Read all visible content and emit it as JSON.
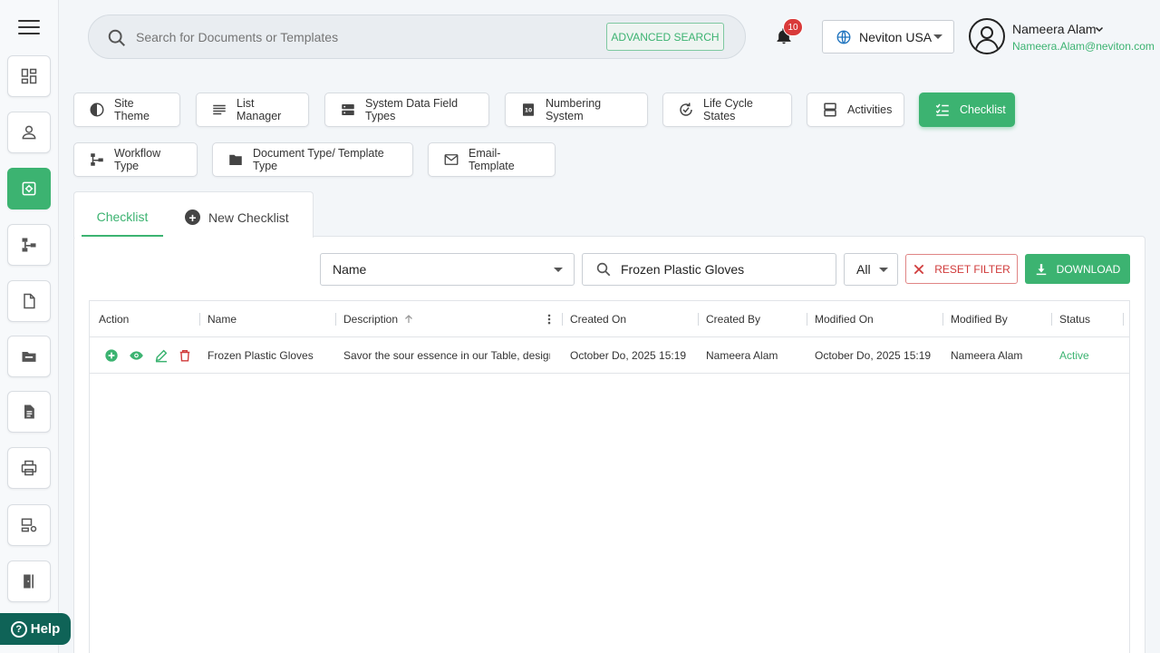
{
  "header": {
    "search_placeholder": "Search for Documents or Templates",
    "advanced_search_label": "ADVANCED SEARCH",
    "notification_count": "10",
    "org_name": "Neviton USA",
    "user_name": "Nameera Alam",
    "user_email": "Nameera.Alam@neviton.com"
  },
  "sidebar": {
    "items": [
      {
        "icon": "dashboard-icon"
      },
      {
        "icon": "user-icon"
      },
      {
        "icon": "settings-icon",
        "active": true
      },
      {
        "icon": "workflow-icon"
      },
      {
        "icon": "document-icon"
      },
      {
        "icon": "folder-icon"
      },
      {
        "icon": "file-text-icon"
      },
      {
        "icon": "printer-icon"
      },
      {
        "icon": "user-settings-icon"
      },
      {
        "icon": "logout-icon"
      }
    ],
    "help_label": "Help"
  },
  "tiles": [
    {
      "label": "Site Theme",
      "icon": "theme-icon"
    },
    {
      "label": "List Manager",
      "icon": "list-icon"
    },
    {
      "label": "System Data Field Types",
      "icon": "server-icon"
    },
    {
      "label": "Numbering System",
      "icon": "numbering-icon"
    },
    {
      "label": "Life Cycle States",
      "icon": "cycle-icon"
    },
    {
      "label": "Activities",
      "icon": "activities-icon"
    },
    {
      "label": "Checklist",
      "icon": "checklist-icon",
      "active": true
    },
    {
      "label": "Workflow Type",
      "icon": "workflow-icon"
    },
    {
      "label": "Document Type/ Template Type",
      "icon": "folder-icon"
    },
    {
      "label": "Email-Template",
      "icon": "mail-icon"
    }
  ],
  "tabs": {
    "checklist_label": "Checklist",
    "new_checklist_label": "New Checklist"
  },
  "filters": {
    "field_value": "Name",
    "search_value": "Frozen Plastic Gloves",
    "status_value": "All",
    "reset_label": "RESET FILTER",
    "download_label": "DOWNLOAD"
  },
  "table": {
    "columns": [
      "Action",
      "Name",
      "Description",
      "Created On",
      "Created By",
      "Modified On",
      "Modified By",
      "Status"
    ],
    "rows": [
      {
        "name": "Frozen Plastic Gloves",
        "description": "Savor the sour essence in our Table, design…",
        "created_on": "October Do, 2025 15:19",
        "created_by": "Nameera Alam",
        "modified_on": "October Do, 2025 15:19",
        "modified_by": "Nameera Alam",
        "status": "Active"
      }
    ]
  },
  "colors": {
    "accent": "#3cb371",
    "danger": "#d03b3b",
    "help_bg": "#0f6357"
  }
}
